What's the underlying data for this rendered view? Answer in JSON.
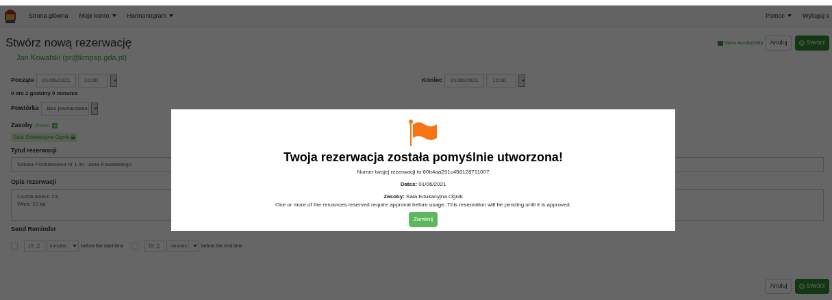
{
  "navbar": {
    "items": [
      {
        "label": "Strona główna",
        "dropdown": false
      },
      {
        "label": "Moje konto",
        "dropdown": true
      },
      {
        "label": "Harmonogram",
        "dropdown": true
      }
    ],
    "right_items": [
      {
        "label": "Pomoc",
        "dropdown": true
      },
      {
        "label": "Wyloguj s",
        "dropdown": false
      }
    ]
  },
  "page": {
    "title": "Stwórz nową rezerwację",
    "user": "Jan Kowalski (pr@kmpsp.gda.pl)",
    "view_availability": "View Availability",
    "cancel": "Anuluj",
    "create": "Stwórz",
    "start": {
      "label": "Począte",
      "date": "01/06/2021",
      "time": "10:00"
    },
    "end": {
      "label": "Koniec",
      "date": "01/06/2021",
      "time": "12:00"
    },
    "duration": "0 dni 2 godziny 0 minutes",
    "repeat": {
      "label": "Powtórka",
      "value": "Bez powtarzania"
    },
    "resources": {
      "label": "Zasoby",
      "change": "Zmień",
      "items": [
        {
          "name": "Sala Edukacyjna Ognik",
          "locked": true
        }
      ]
    },
    "title_field": {
      "label": "Tytuł rezerwacji",
      "value": "Szkoła Podstawowa nr 1 im. Jana Kowalskiego"
    },
    "description": {
      "label": "Opis rezerwacji",
      "lines": [
        "Liczba dzieci: 23",
        "Wiek: 10 lat"
      ]
    },
    "reminder": {
      "label": "Send Reminder",
      "items": [
        {
          "checked": false,
          "amount": "15",
          "unit": "minutes",
          "text": "before the start time"
        },
        {
          "checked": false,
          "amount": "15",
          "unit": "minutes",
          "text": "before the end time"
        }
      ]
    },
    "bottom_cancel": "Anuluj",
    "bottom_create": "Stwórz"
  },
  "modal": {
    "title": "Twoja rezerwacja została pomyślnie utworzona!",
    "number": "Numer twojej rezerwacji to 60b4aa291c458128711007",
    "dates": "**Dates:** 01/06/2021",
    "resources": "**Zasoby:** Sala Edukacyjna Ognik",
    "note": "One or more of the resources reserved require approval before usage. This reservation will be pending until it is approved.",
    "close": "Zamknij"
  }
}
